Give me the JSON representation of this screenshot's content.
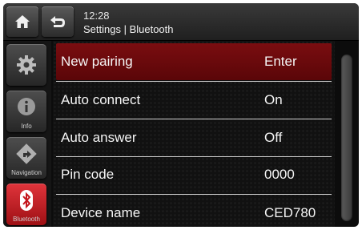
{
  "header": {
    "time": "12:28",
    "breadcrumb": "Settings | Bluetooth"
  },
  "sidebar": {
    "items": [
      {
        "label": "",
        "icon": "gear-icon"
      },
      {
        "label": "Info",
        "icon": "info-icon"
      },
      {
        "label": "Navigation",
        "icon": "navigation-icon"
      },
      {
        "label": "Bluetooth",
        "icon": "bluetooth-icon",
        "active": true
      }
    ]
  },
  "settings": {
    "rows": [
      {
        "label": "New pairing",
        "value": "Enter",
        "selected": true
      },
      {
        "label": "Auto connect",
        "value": "On"
      },
      {
        "label": "Auto answer",
        "value": "Off"
      },
      {
        "label": "Pin code",
        "value": "0000"
      },
      {
        "label": "Device name",
        "value": "CED780"
      }
    ]
  },
  "colors": {
    "accent": "#c4161c",
    "selected_row": "#6a0a0c"
  }
}
